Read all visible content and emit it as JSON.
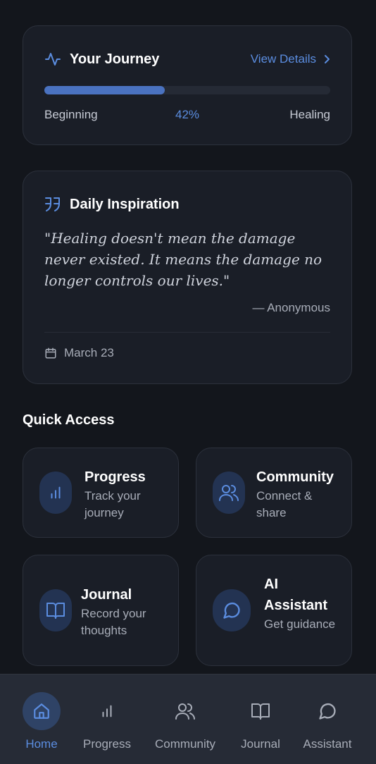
{
  "journey": {
    "title": "Your Journey",
    "link_label": "View Details",
    "progress": 0.42,
    "start_label": "Beginning",
    "percent_label": "42%",
    "end_label": "Healing"
  },
  "inspiration": {
    "title": "Daily Inspiration",
    "quote": "\"Healing doesn't mean the damage never existed. It means the damage no longer controls our lives.\"",
    "author": "— Anonymous",
    "date": "March 23"
  },
  "quick_access": {
    "title": "Quick Access",
    "tiles": [
      {
        "title": "Progress",
        "subtitle": "Track your journey",
        "icon": "bar-chart-icon"
      },
      {
        "title": "Community",
        "subtitle": "Connect & share",
        "icon": "users-icon"
      },
      {
        "title": "Journal",
        "subtitle": "Record your thoughts",
        "icon": "book-icon"
      },
      {
        "title": "AI Assistant",
        "subtitle": "Get guidance",
        "icon": "chat-bubble-icon"
      }
    ]
  },
  "nav": {
    "items": [
      {
        "label": "Home",
        "icon": "home-icon",
        "active": true
      },
      {
        "label": "Progress",
        "icon": "bar-chart-icon"
      },
      {
        "label": "Community",
        "icon": "users-icon"
      },
      {
        "label": "Journal",
        "icon": "book-icon"
      },
      {
        "label": "Assistant",
        "icon": "chat-bubble-icon"
      }
    ]
  },
  "colors": {
    "background": "#13161c",
    "card": "#1a1e27",
    "accent": "#5b8de0",
    "progress_fill": "#4a72c0",
    "icon_bg": "#233352",
    "nav_bg": "#262b36"
  }
}
